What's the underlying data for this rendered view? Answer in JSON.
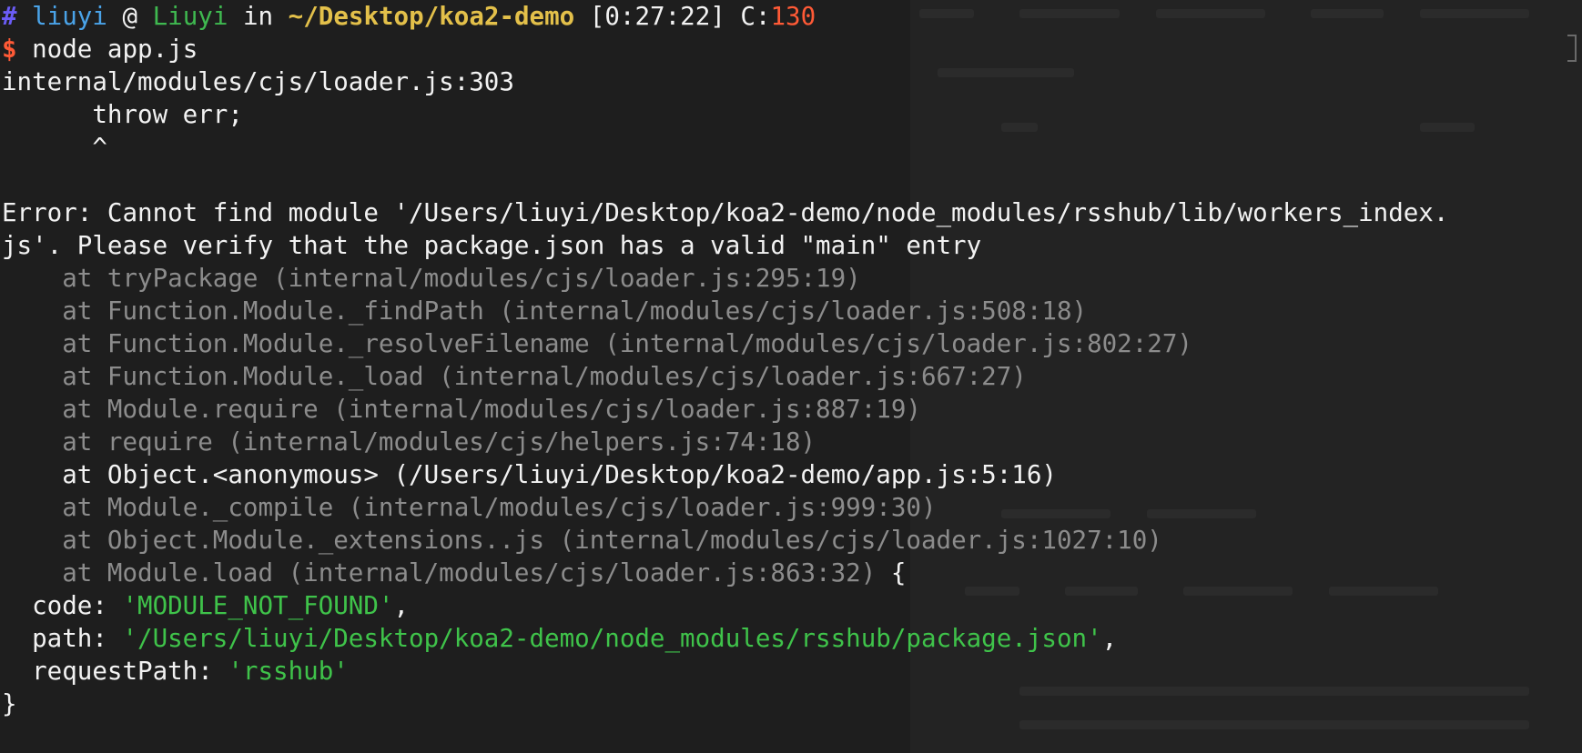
{
  "prompt": {
    "hash": "#",
    "user": "liuyi",
    "at": "@",
    "host": "Liuyi",
    "in": "in",
    "path": "~/Desktop/koa2-demo",
    "time": "[0:27:22]",
    "code_label": "C:",
    "code_value": "130",
    "dollar": "$",
    "command": "node app.js"
  },
  "output": {
    "loader_line": "internal/modules/cjs/loader.js:303",
    "throw_line": "      throw err;",
    "caret_line": "      ^",
    "error_line_1": "Error: Cannot find module '/Users/liuyi/Desktop/koa2-demo/node_modules/rsshub/lib/workers_index.",
    "error_line_2": "js'. Please verify that the package.json has a valid \"main\" entry",
    "stack": [
      {
        "prefix": "    at ",
        "text": "tryPackage (internal/modules/cjs/loader.js:295:19)",
        "highlight": false
      },
      {
        "prefix": "    at ",
        "text": "Function.Module._findPath (internal/modules/cjs/loader.js:508:18)",
        "highlight": false
      },
      {
        "prefix": "    at ",
        "text": "Function.Module._resolveFilename (internal/modules/cjs/loader.js:802:27)",
        "highlight": false
      },
      {
        "prefix": "    at ",
        "text": "Function.Module._load (internal/modules/cjs/loader.js:667:27)",
        "highlight": false
      },
      {
        "prefix": "    at ",
        "text": "Module.require (internal/modules/cjs/loader.js:887:19)",
        "highlight": false
      },
      {
        "prefix": "    at ",
        "text": "require (internal/modules/cjs/helpers.js:74:18)",
        "highlight": false
      },
      {
        "prefix": "    at ",
        "text": "Object.<anonymous> (/Users/liuyi/Desktop/koa2-demo/app.js:5:16)",
        "highlight": true
      },
      {
        "prefix": "    at ",
        "text": "Module._compile (internal/modules/cjs/loader.js:999:30)",
        "highlight": false
      },
      {
        "prefix": "    at ",
        "text": "Object.Module._extensions..js (internal/modules/cjs/loader.js:1027:10)",
        "highlight": false
      },
      {
        "prefix": "    at ",
        "text": "Module.load (internal/modules/cjs/loader.js:863:32)",
        "highlight": false
      }
    ],
    "open_brace": " {",
    "props": [
      {
        "key": "  code: ",
        "value": "'MODULE_NOT_FOUND'",
        "suffix": ","
      },
      {
        "key": "  path: ",
        "value": "'/Users/liuyi/Desktop/koa2-demo/node_modules/rsshub/package.json'",
        "suffix": ","
      },
      {
        "key": "  requestPath: ",
        "value": "'rsshub'",
        "suffix": ""
      }
    ],
    "close_brace": "}"
  },
  "colors": {
    "background": "#1e1e1e",
    "text": "#f2f2f2",
    "dim": "#8c8c8c",
    "string": "#3fc34a",
    "prompt_user": "#4aa3e8",
    "prompt_host": "#3fb950",
    "prompt_path": "#e3c04a",
    "prompt_error": "#ff5a36",
    "prompt_hash": "#6b5cf6"
  }
}
